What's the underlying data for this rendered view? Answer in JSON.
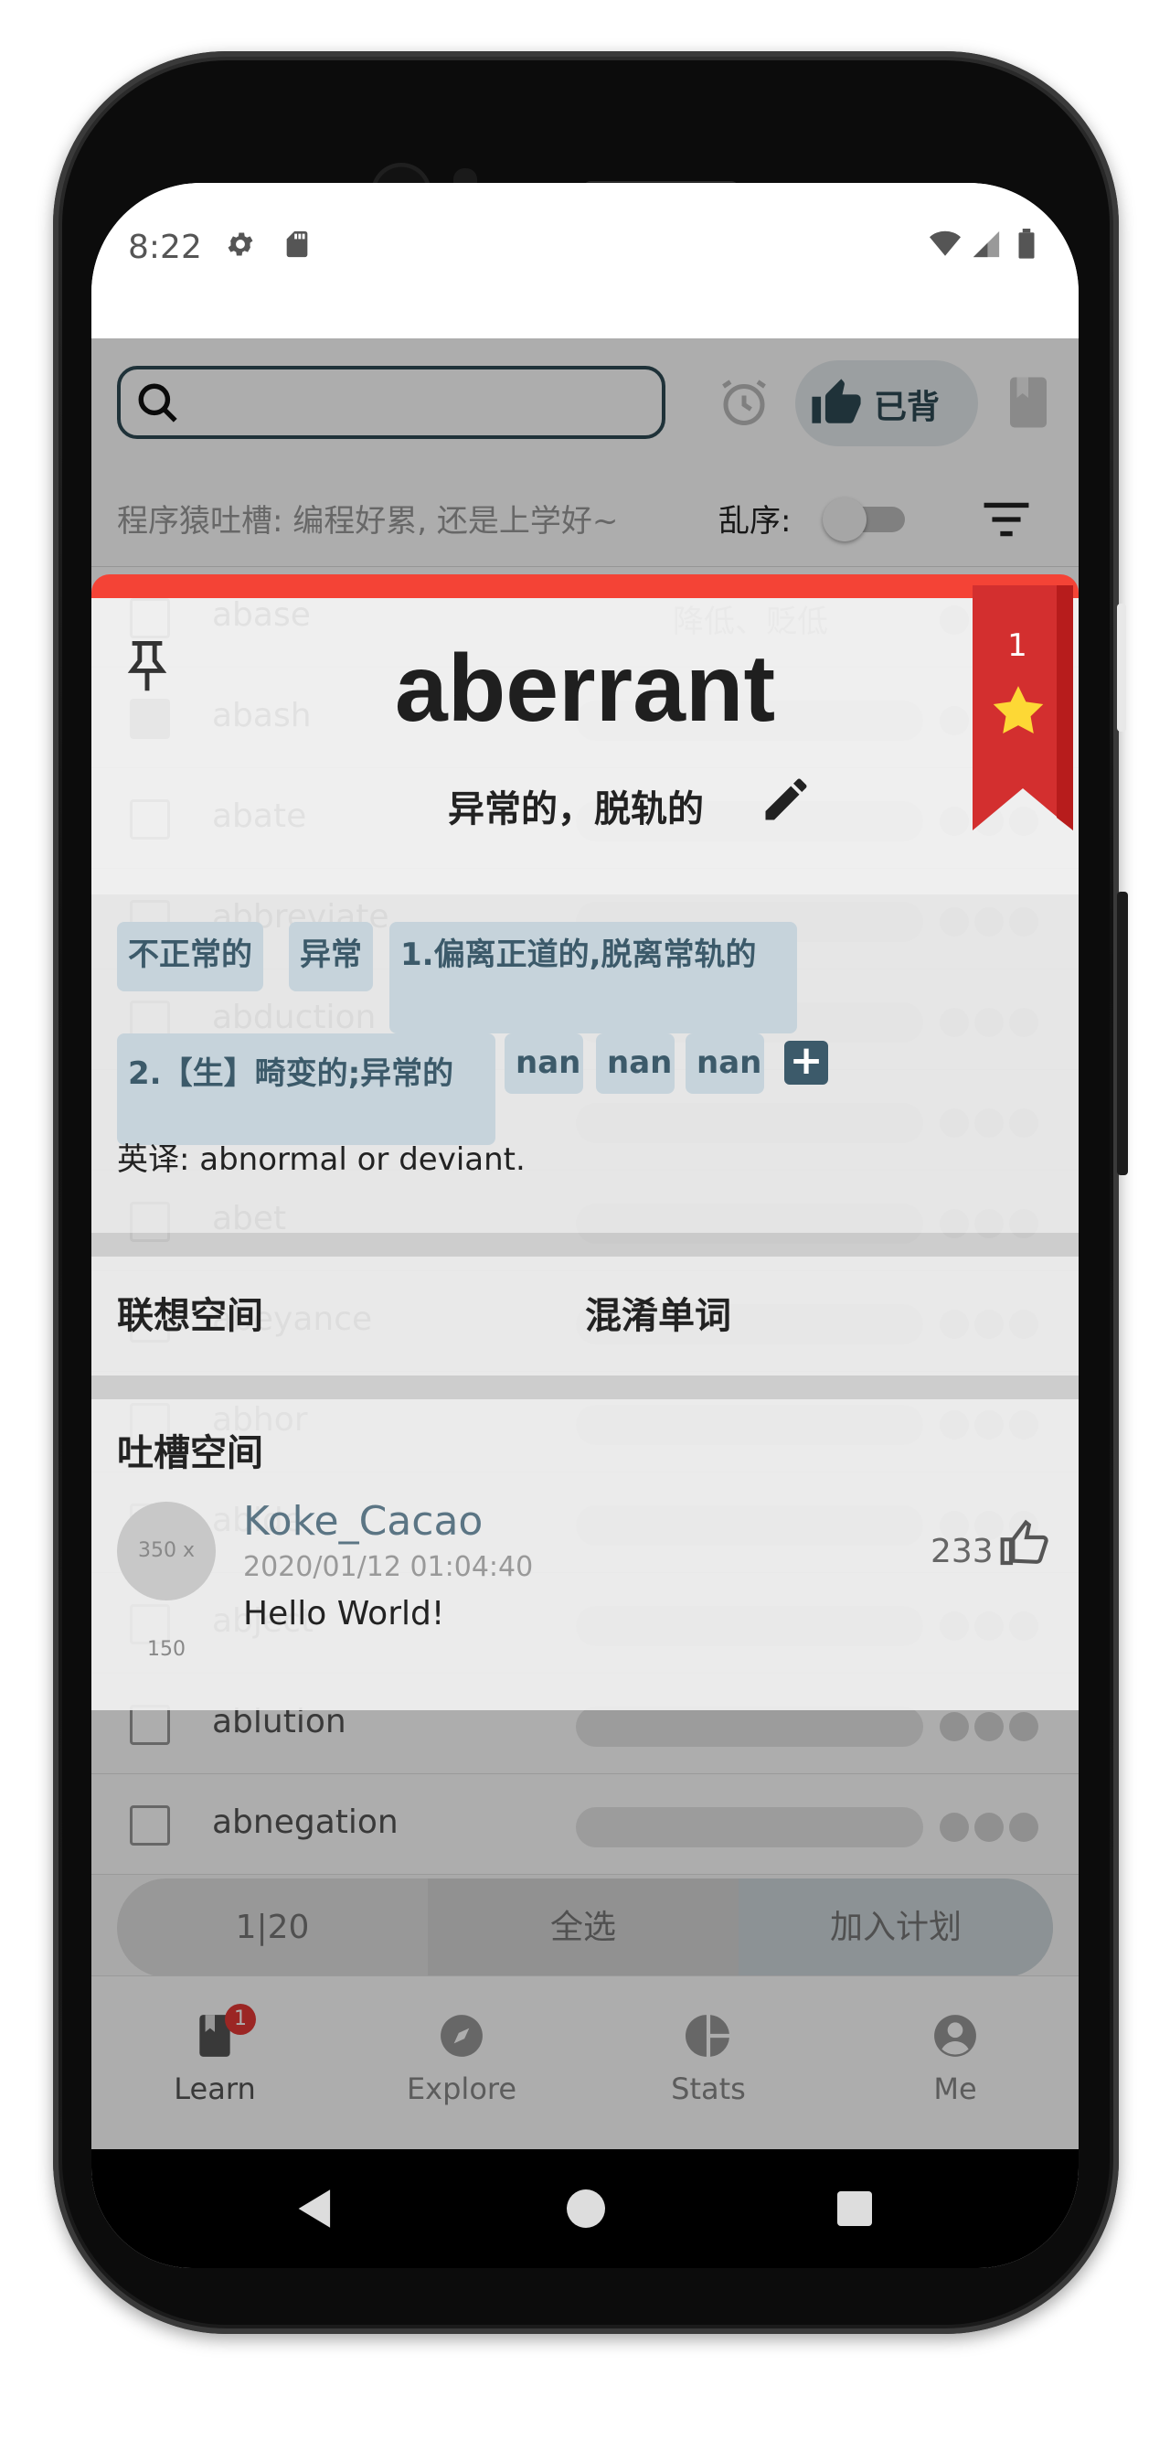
{
  "status_bar": {
    "time": "8:22",
    "icons": [
      "gear-icon",
      "sd-card-icon",
      "wifi-icon",
      "signal-icon",
      "battery-icon"
    ]
  },
  "app_bar": {
    "search_placeholder": "",
    "learned_button_label": "已背",
    "tagline": "程序猿吐槽: 编程好累, 还是上学好~",
    "shuffle_label": "乱序:",
    "shuffle_on": false
  },
  "word_list": [
    {
      "word": "abase",
      "meaning": "降低、贬低",
      "checked": false
    },
    {
      "word": "abash",
      "meaning": "",
      "checked": true
    },
    {
      "word": "abate",
      "meaning": "",
      "checked": false
    },
    {
      "word": "abbreviate",
      "meaning": "",
      "checked": false
    },
    {
      "word": "abduction",
      "meaning": "",
      "checked": false
    },
    {
      "word": "aberrant",
      "meaning": "",
      "checked": false
    },
    {
      "word": "abet",
      "meaning": "",
      "checked": false
    },
    {
      "word": "abeyance",
      "meaning": "",
      "checked": false
    },
    {
      "word": "abhor",
      "meaning": "",
      "checked": false
    },
    {
      "word": "abide",
      "meaning": "",
      "checked": false
    },
    {
      "word": "abject",
      "meaning": "",
      "checked": false
    },
    {
      "word": "ablution",
      "meaning": "",
      "checked": false
    },
    {
      "word": "abnegation",
      "meaning": "",
      "checked": false
    }
  ],
  "bottom_actions": {
    "page": "1|20",
    "select_all": "全选",
    "add_plan": "加入计划"
  },
  "bottom_nav": [
    {
      "label": "Learn",
      "icon": "book-icon",
      "badge": "1"
    },
    {
      "label": "Explore",
      "icon": "compass-icon"
    },
    {
      "label": "Stats",
      "icon": "pie-chart-icon"
    },
    {
      "label": "Me",
      "icon": "account-icon"
    }
  ],
  "dialog": {
    "word": "aberrant",
    "meaning": "异常的，脱轨的",
    "ribbon_count": "1",
    "tags": [
      "不正常的",
      "异常",
      "1.偏离正道的,脱离常轨的",
      "2.【生】畸变的;异常的",
      "nan",
      "nan",
      "nan"
    ],
    "translation": "英译: abnormal or deviant.",
    "association_title": "联想空间",
    "confusing_title": "混淆单词",
    "comments_title": "吐槽空间",
    "comment": {
      "avatar_text": "350 x 150",
      "user": "Koke_Cacao",
      "time": "2020/01/12 01:04:40",
      "text": "Hello World!",
      "likes": "233"
    }
  },
  "colors": {
    "accent": "#f44336",
    "chip_bg": "#c6d3db",
    "chip_text": "#3c5a6a",
    "ribbon": "#d32f2f",
    "star": "#fdd835"
  }
}
